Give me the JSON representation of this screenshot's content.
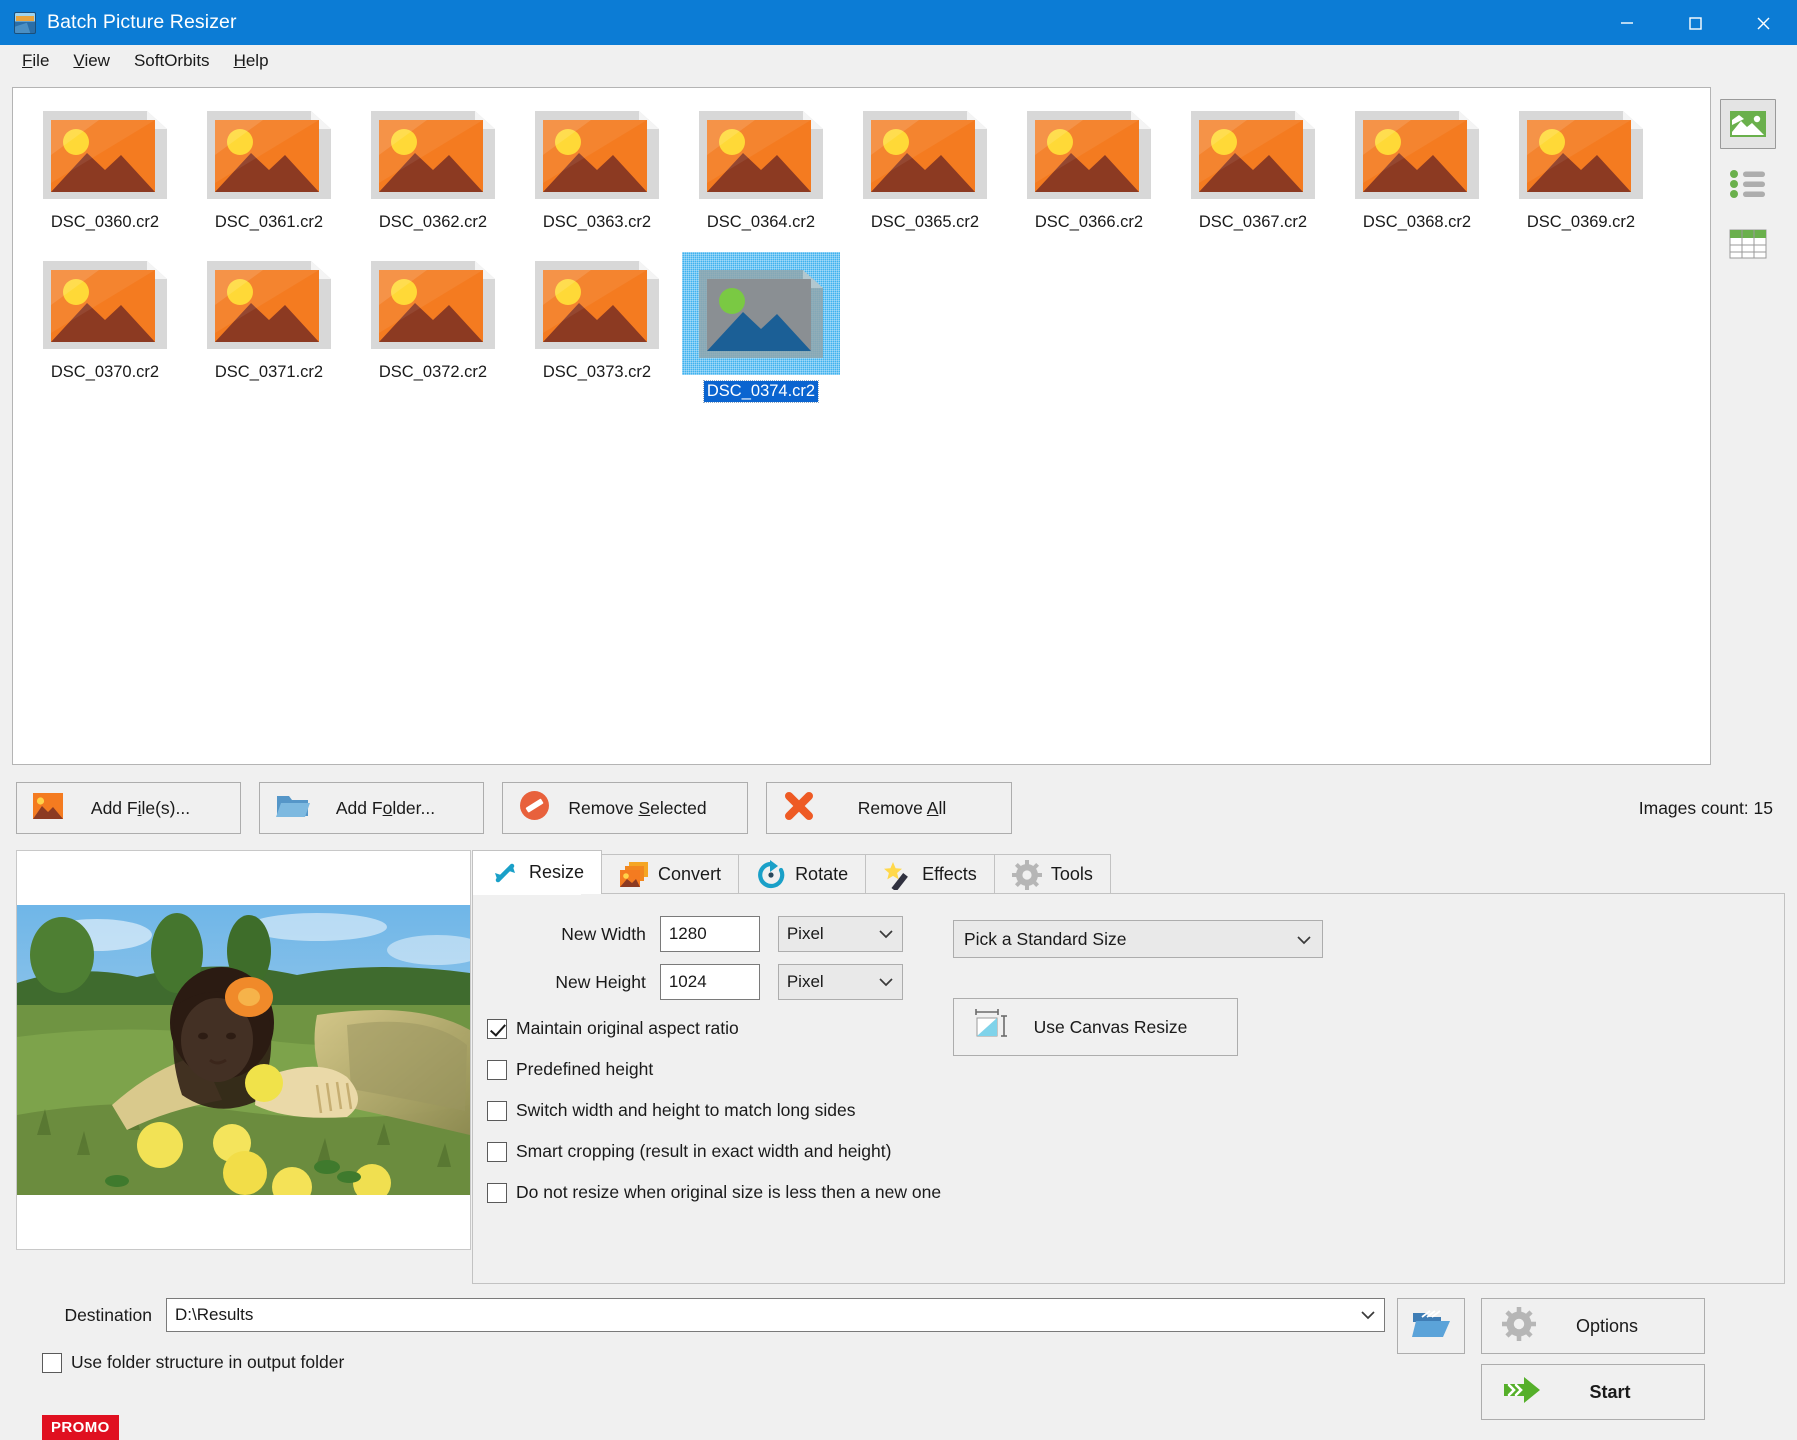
{
  "window": {
    "title": "Batch Picture Resizer",
    "icon": "app-icon",
    "controls": {
      "minimize": "minimize-icon",
      "maximize": "maximize-icon",
      "close": "close-icon"
    }
  },
  "menu": {
    "items": [
      {
        "label": "File",
        "accel": "F"
      },
      {
        "label": "View",
        "accel": "V"
      },
      {
        "label": "SoftOrbits",
        "accel": ""
      },
      {
        "label": "Help",
        "accel": "H"
      }
    ]
  },
  "filelist": {
    "items": [
      {
        "name": "DSC_0360.cr2",
        "selected": false
      },
      {
        "name": "DSC_0361.cr2",
        "selected": false
      },
      {
        "name": "DSC_0362.cr2",
        "selected": false
      },
      {
        "name": "DSC_0363.cr2",
        "selected": false
      },
      {
        "name": "DSC_0364.cr2",
        "selected": false
      },
      {
        "name": "DSC_0365.cr2",
        "selected": false
      },
      {
        "name": "DSC_0366.cr2",
        "selected": false
      },
      {
        "name": "DSC_0367.cr2",
        "selected": false
      },
      {
        "name": "DSC_0368.cr2",
        "selected": false
      },
      {
        "name": "DSC_0369.cr2",
        "selected": false
      },
      {
        "name": "DSC_0370.cr2",
        "selected": false
      },
      {
        "name": "DSC_0371.cr2",
        "selected": false
      },
      {
        "name": "DSC_0372.cr2",
        "selected": false
      },
      {
        "name": "DSC_0373.cr2",
        "selected": false
      },
      {
        "name": "DSC_0374.cr2",
        "selected": true
      }
    ]
  },
  "view_modes": [
    {
      "name": "thumbnail-view",
      "icon": "image-thumbnail-icon",
      "active": true
    },
    {
      "name": "list-view",
      "icon": "bulleted-list-icon",
      "active": false
    },
    {
      "name": "details-view",
      "icon": "table-grid-icon",
      "active": false
    }
  ],
  "actions": {
    "add_files": {
      "label": "Add File(s)...",
      "accel": "i",
      "icon": "picture-icon"
    },
    "add_folder": {
      "label": "Add Folder...",
      "accel": "o",
      "icon": "folder-icon"
    },
    "remove_selected": {
      "label": "Remove Selected",
      "accel": "S",
      "icon": "no-entry-icon"
    },
    "remove_all": {
      "label": "Remove All",
      "accel": "A",
      "icon": "red-x-icon"
    },
    "images_count": "Images count: 15"
  },
  "tabs": [
    {
      "label": "Resize",
      "icon": "resize-arrows-icon",
      "active": true
    },
    {
      "label": "Convert",
      "icon": "convert-images-icon",
      "active": false
    },
    {
      "label": "Rotate",
      "icon": "rotate-circular-arrow-icon",
      "active": false
    },
    {
      "label": "Effects",
      "icon": "magic-wand-icon",
      "active": false
    },
    {
      "label": "Tools",
      "icon": "gear-icon",
      "active": false
    }
  ],
  "resize": {
    "new_width": {
      "label": "New Width",
      "value": "1280",
      "unit": "Pixel"
    },
    "new_height": {
      "label": "New Height",
      "value": "1024",
      "unit": "Pixel"
    },
    "checkboxes": [
      {
        "label": "Maintain original aspect ratio",
        "checked": true
      },
      {
        "label": "Predefined height",
        "checked": false
      },
      {
        "label": "Switch width and height to match long sides",
        "checked": false
      },
      {
        "label": "Smart cropping (result in exact width and height)",
        "checked": false
      },
      {
        "label": "Do not resize when original size is less then a new one",
        "checked": false
      }
    ],
    "standard_size": {
      "value": "Pick a Standard Size"
    },
    "canvas_resize": {
      "label": "Use Canvas Resize",
      "icon": "canvas-resize-icon"
    }
  },
  "preview": {
    "alt": "preview-photo-woman-in-grass-with-apples"
  },
  "destination": {
    "label": "Destination",
    "value": "D:\\Results",
    "folder_structure": {
      "label": "Use folder structure in output folder",
      "checked": false
    },
    "promo_badge": "PROMO",
    "browse_icon": "open-folder-icon"
  },
  "footer_buttons": {
    "options": {
      "label": "Options",
      "icon": "gear-icon"
    },
    "start": {
      "label": "Start",
      "icon": "green-arrow-icon"
    }
  },
  "colors": {
    "titlebar": "#0c7cd5",
    "accent_selection": "#0a64d0",
    "promo_red": "#e01020",
    "start_green": "#5cb332",
    "face": "#f0f0f0"
  }
}
